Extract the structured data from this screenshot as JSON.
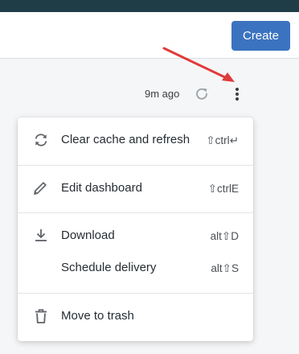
{
  "header": {
    "create_label": "Create"
  },
  "toolbar": {
    "last_updated": "9m ago"
  },
  "menu": {
    "items": [
      {
        "label": "Clear cache and refresh",
        "shortcut": "⇧ctrl↵",
        "icon": "refresh-icon"
      },
      {
        "label": "Edit dashboard",
        "shortcut": "⇧ctrlE",
        "icon": "pencil-icon"
      },
      {
        "label": "Download",
        "shortcut": "alt⇧D",
        "icon": "download-icon"
      },
      {
        "label": "Schedule delivery",
        "shortcut": "alt⇧S",
        "icon": ""
      },
      {
        "label": "Move to trash",
        "shortcut": "",
        "icon": "trash-icon"
      }
    ]
  },
  "colors": {
    "top_bar": "#1f3d47",
    "create_button": "#3b73c0",
    "annotation_arrow": "#e03a3a"
  }
}
